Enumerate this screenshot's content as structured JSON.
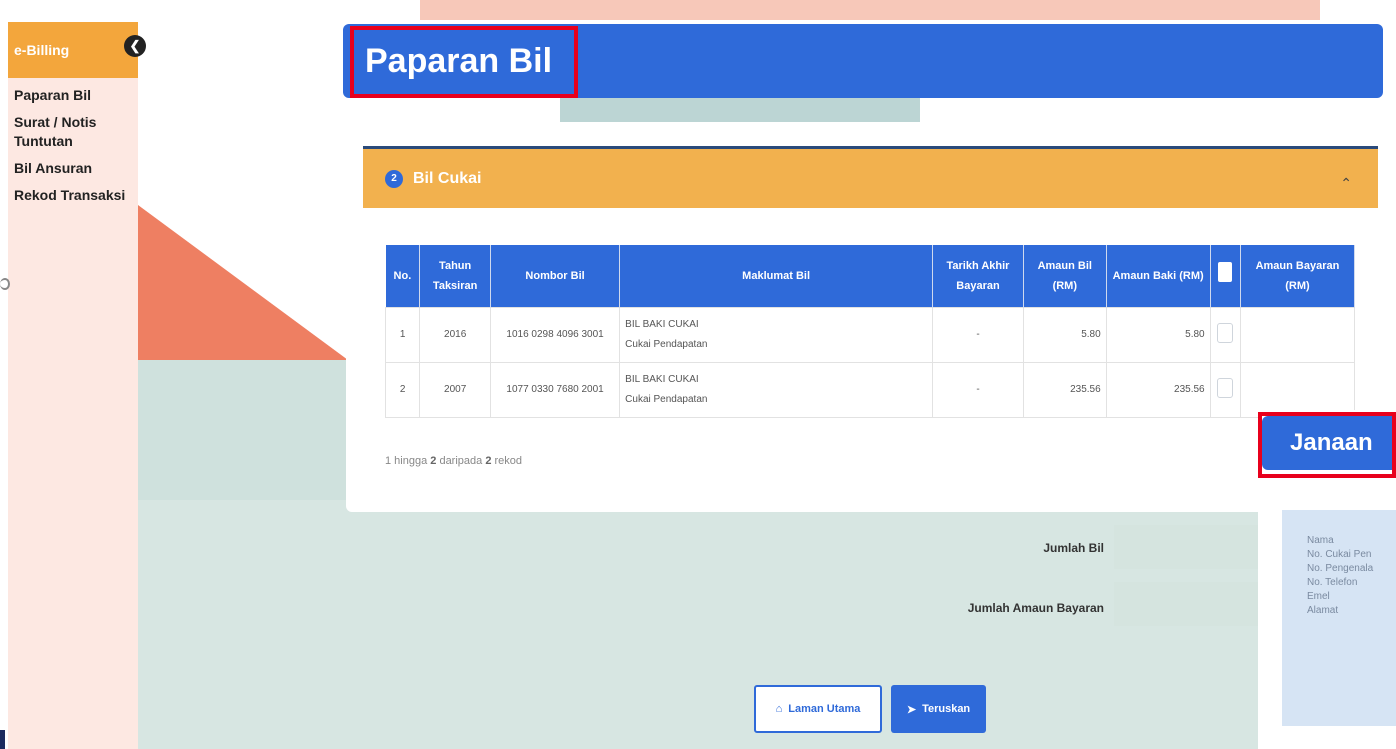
{
  "sidebar": {
    "title": "e-Billing",
    "collapse_icon": "chevron-left-icon",
    "items": [
      {
        "label": "Paparan Bil"
      },
      {
        "label": "Surat / Notis Tuntutan"
      },
      {
        "label": "Bil Ansuran"
      },
      {
        "label": "Rekod Transaksi"
      }
    ]
  },
  "page": {
    "title": "Paparan Bil"
  },
  "accordion": {
    "number": "2",
    "title": "Bil Cukai",
    "chevron_icon": "chevron-up-icon"
  },
  "table": {
    "headers": [
      "No.",
      "Tahun Taksiran",
      "Nombor Bil",
      "Maklumat Bil",
      "Tarikh Akhir Bayaran",
      "Amaun Bil (RM)",
      "Amaun Baki (RM)",
      "",
      "Amaun Bayaran (RM)"
    ],
    "rows": [
      {
        "no": "1",
        "tahun": "2016",
        "nombor": "1016 0298 4096 3001",
        "maklumat_1": "BIL BAKI CUKAI",
        "maklumat_2": "Cukai Pendapatan",
        "tarikh": "-",
        "amaun_bil": "5.80",
        "amaun_baki": "5.80",
        "amaun_bayaran": ""
      },
      {
        "no": "2",
        "tahun": "2007",
        "nombor": "1077 0330 7680 2001",
        "maklumat_1": "BIL BAKI CUKAI",
        "maklumat_2": "Cukai Pendapatan",
        "tarikh": "-",
        "amaun_bil": "235.56",
        "amaun_baki": "235.56",
        "amaun_bayaran": ""
      }
    ]
  },
  "records": {
    "prefix": "1 hingga ",
    "to": "2",
    "mid": " daripada ",
    "total": "2",
    "suffix": " rekod"
  },
  "summary": {
    "jumlah_bil_label": "Jumlah Bil",
    "jumlah_amaun_label": "Jumlah Amaun Bayaran"
  },
  "buttons": {
    "home_label": "Laman Utama",
    "home_icon": "home-icon",
    "next_label": "Teruskan",
    "next_icon": "arrow-circle-right-icon"
  },
  "overlay": {
    "title": "Janaan",
    "fields": [
      "Nama",
      "No. Cukai Pen",
      "No. Pengenala",
      "No. Telefon",
      "Emel",
      "Alamat"
    ]
  },
  "colors": {
    "primary": "#2f6ad9",
    "accent_orange": "#f2b14e",
    "highlight_red": "#e8001c"
  }
}
